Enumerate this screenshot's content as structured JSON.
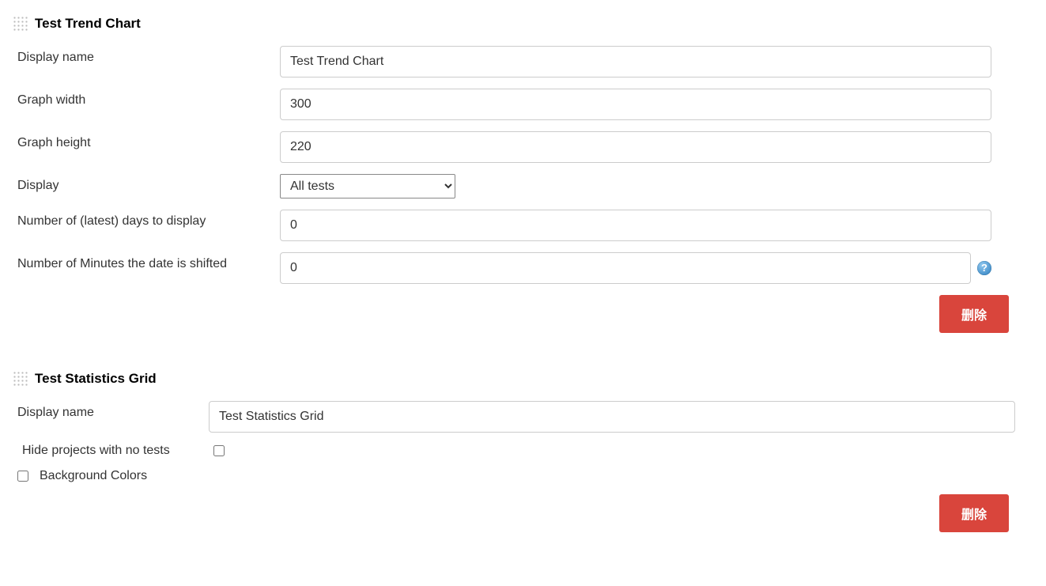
{
  "sections": {
    "trend": {
      "title": "Test Trend Chart",
      "labels": {
        "display_name": "Display name",
        "graph_width": "Graph width",
        "graph_height": "Graph height",
        "display": "Display",
        "days": "Number of (latest) days to display",
        "shift": "Number of Minutes the date is shifted"
      },
      "values": {
        "display_name": "Test Trend Chart",
        "graph_width": "300",
        "graph_height": "220",
        "display_selected": "All tests",
        "days": "0",
        "shift": "0"
      },
      "delete_label": "删除"
    },
    "stats": {
      "title": "Test Statistics Grid",
      "labels": {
        "display_name": "Display name",
        "hide_no_tests": "Hide projects with no tests",
        "background_colors": "Background Colors"
      },
      "values": {
        "display_name": "Test Statistics Grid"
      },
      "delete_label": "删除"
    }
  },
  "help_glyph": "?"
}
